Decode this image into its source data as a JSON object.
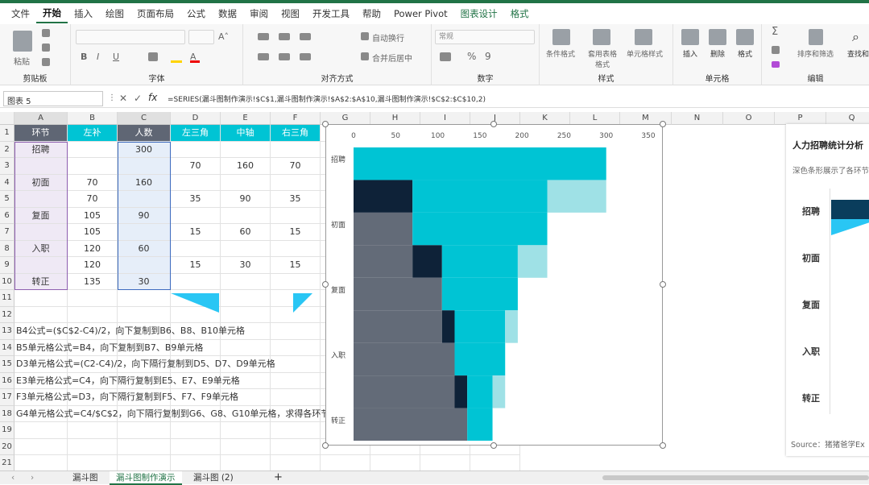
{
  "menu": [
    "文件",
    "开始",
    "插入",
    "绘图",
    "页面布局",
    "公式",
    "数据",
    "审阅",
    "视图",
    "开发工具",
    "帮助",
    "Power Pivot",
    "图表设计",
    "格式"
  ],
  "ribbon": {
    "paste": "粘贴",
    "clipboard": "剪贴板",
    "font": "字体",
    "align": "对齐方式",
    "number": "数字",
    "styles": "样式",
    "cells": "单元格",
    "edit": "编辑",
    "wrap": "自动换行",
    "merge": "合并后居中",
    "numfmt": "常规",
    "cond": "条件格式",
    "table": "套用表格格式",
    "cellstyle": "单元格样式",
    "insert": "插入",
    "delete": "删除",
    "format": "格式",
    "sort": "排序和筛选",
    "find": "查找和选择"
  },
  "namebox": "图表 5",
  "formula": "=SERIES(漏斗图制作演示!$C$1,漏斗图制作演示!$A$2:$A$10,漏斗图制作演示!$C$2:$C$10,2)",
  "columns": [
    "A",
    "B",
    "C",
    "D",
    "E",
    "F",
    "G",
    "H",
    "I",
    "J",
    "K",
    "L",
    "M",
    "N",
    "O",
    "P",
    "Q"
  ],
  "rows": [
    "1",
    "2",
    "3",
    "4",
    "5",
    "6",
    "7",
    "8",
    "9",
    "10",
    "11",
    "12",
    "13",
    "14",
    "15",
    "16",
    "17",
    "18",
    "19",
    "20",
    "21"
  ],
  "header": [
    "环节",
    "左补",
    "人数",
    "左三角",
    "中轴",
    "右三角"
  ],
  "table": [
    [
      "招聘",
      "",
      "300",
      "",
      "",
      ""
    ],
    [
      "",
      "",
      "",
      "70",
      "160",
      "70"
    ],
    [
      "初面",
      "70",
      "160",
      "",
      "",
      ""
    ],
    [
      "",
      "70",
      "",
      "35",
      "90",
      "35"
    ],
    [
      "复面",
      "105",
      "90",
      "",
      "",
      ""
    ],
    [
      "",
      "105",
      "",
      "15",
      "60",
      "15"
    ],
    [
      "入职",
      "120",
      "60",
      "",
      "",
      ""
    ],
    [
      "",
      "120",
      "",
      "15",
      "30",
      "15"
    ],
    [
      "转正",
      "135",
      "30",
      "",
      "",
      ""
    ]
  ],
  "notes": [
    "B4公式=($C$2-C4)/2，向下复制到B6、B8、B10单元格",
    "B5单元格公式=B4，向下复制到B7、B9单元格",
    "D3单元格公式=(C2-C4)/2，向下隔行复制到D5、D7、D9单元格",
    "E3单元格公式=C4，向下隔行复制到E5、E7、E9单元格",
    "F3单元格公式=D3，向下隔行复制到F5、F7、F9单元格",
    "G4单元格公式=C4/$C$2，向下隔行复制到G6、G8、G10单元格，求得各环节"
  ],
  "chart_data": {
    "type": "bar",
    "orientation": "horizontal-stacked",
    "xlim": [
      0,
      350
    ],
    "xticks": [
      "0",
      "50",
      "100",
      "150",
      "200",
      "250",
      "300",
      "350"
    ],
    "categories": [
      "招聘",
      "",
      "初面",
      "",
      "复面",
      "",
      "入职",
      "",
      "转正"
    ],
    "series": [
      {
        "values": [
          0,
          0,
          70,
          70,
          105,
          105,
          120,
          120,
          135
        ],
        "color": "#636b78"
      },
      {
        "values": [
          0,
          70,
          0,
          35,
          0,
          15,
          0,
          15,
          0
        ],
        "color": "#0e2238"
      },
      {
        "values": [
          300,
          160,
          160,
          90,
          90,
          60,
          60,
          30,
          30
        ],
        "color": "#00c4d4"
      },
      {
        "values": [
          0,
          70,
          0,
          35,
          0,
          15,
          0,
          15,
          0
        ],
        "color": "#9fe1e6"
      }
    ]
  },
  "chart2": {
    "title": "人力招聘统计分析",
    "subtitle": "深色条形展示了各环节",
    "labels": [
      "招聘",
      "初面",
      "复面",
      "入职",
      "转正"
    ],
    "source": "Source：猪猪爸学Ex"
  },
  "sheets": [
    "漏斗图",
    "漏斗图制作演示",
    "漏斗图 (2)"
  ]
}
